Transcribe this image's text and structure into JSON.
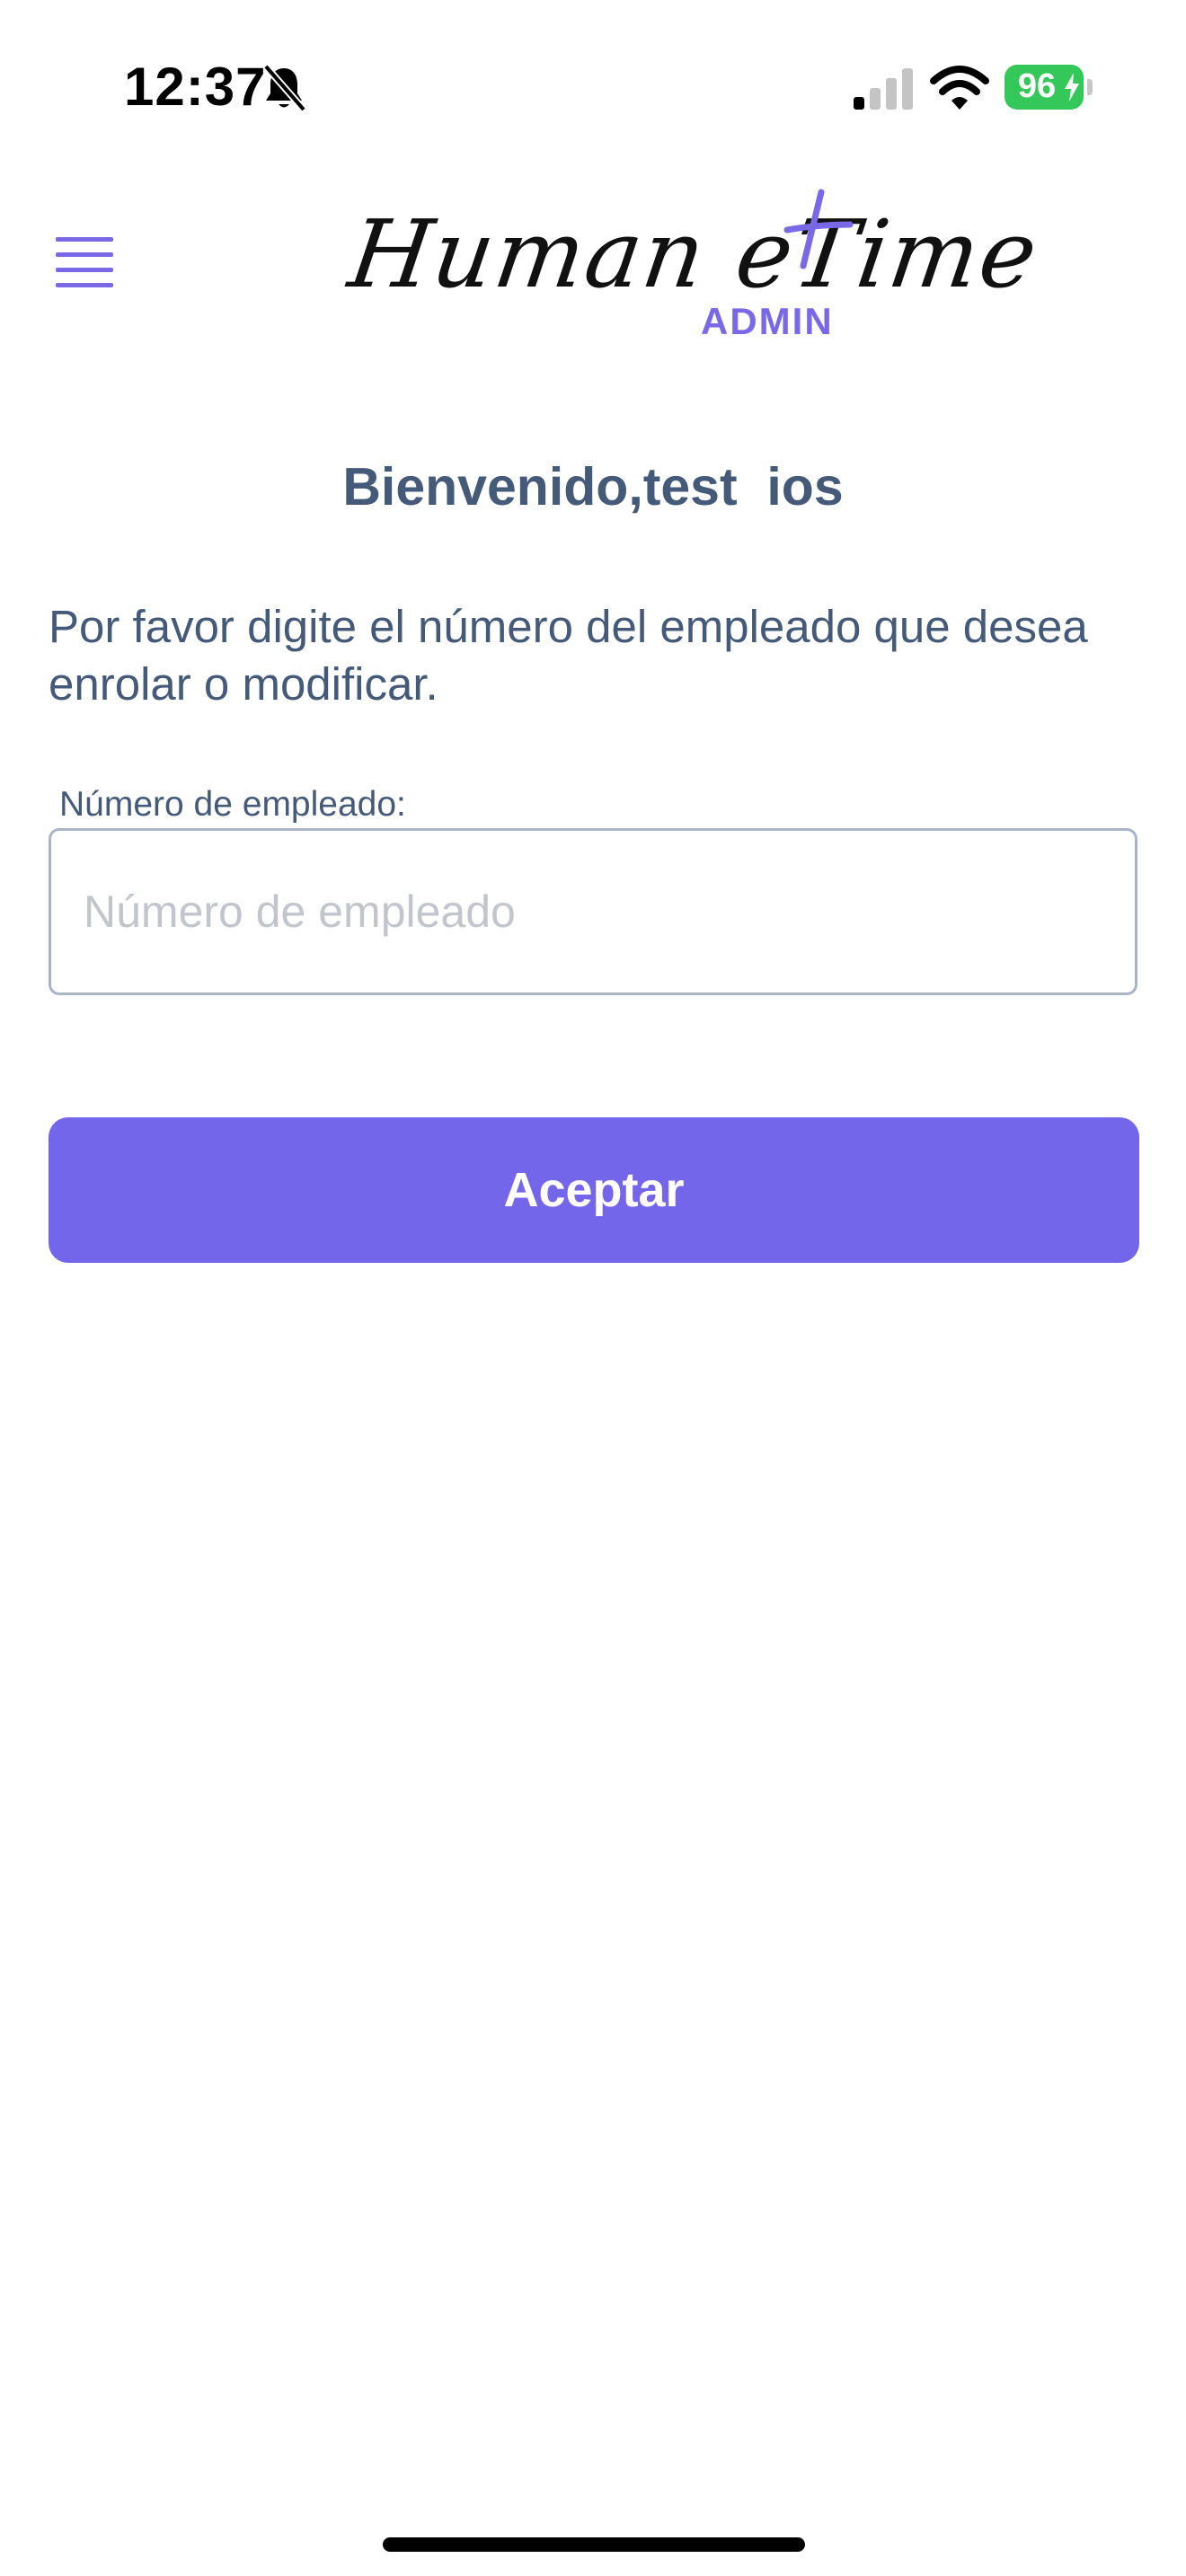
{
  "status_bar": {
    "time": "12:37",
    "battery_level": "96",
    "icons": [
      "bell-slash-icon",
      "cellular-signal-icon",
      "wifi-icon",
      "battery-charging-icon"
    ],
    "battery_color": "#34c759"
  },
  "header": {
    "menu_icon": "hamburger-menu-icon",
    "logo_text": "Human eTime",
    "logo_badge": "ADMIN",
    "accent_color": "#7a69e6"
  },
  "main": {
    "welcome": "Bienvenido,test  ios",
    "instructions": "Por favor digite el número del empleado que desea enrolar o modificar.",
    "employee_field": {
      "label": "Número de empleado:",
      "placeholder": "Número de empleado",
      "value": ""
    },
    "accept_button": {
      "label": "Aceptar",
      "color": "#7466eb"
    }
  }
}
